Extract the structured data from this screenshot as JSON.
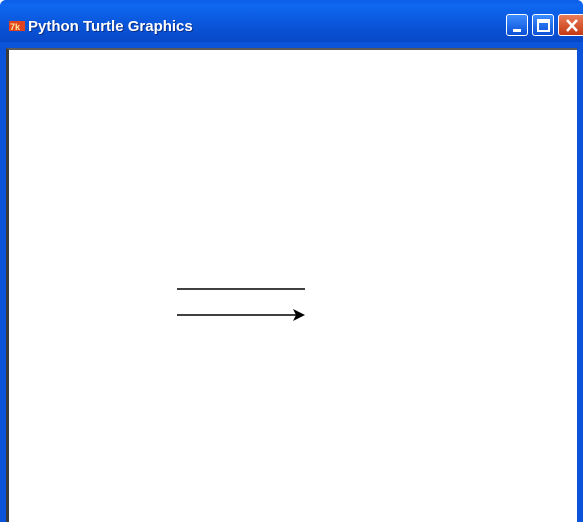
{
  "window": {
    "title": "Python Turtle Graphics",
    "icon": "turtle-app-icon",
    "controls": [
      "minimize-icon",
      "maximize-icon",
      "close-icon"
    ]
  },
  "canvas": {
    "background": "#ffffff",
    "drawing": {
      "lines": 2,
      "turtle": "arrow-cursor"
    }
  }
}
